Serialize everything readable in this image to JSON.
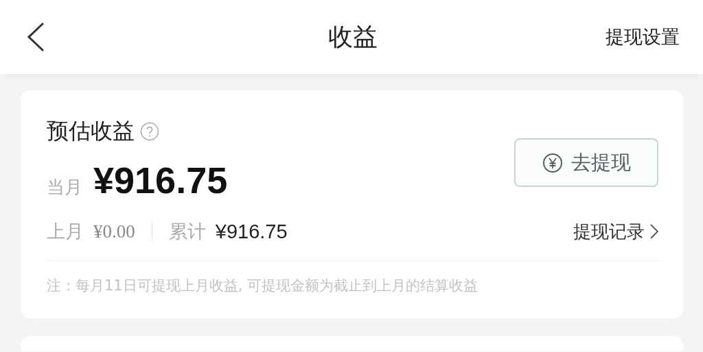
{
  "header": {
    "title": "收益",
    "action": "提现设置"
  },
  "earnings_card": {
    "title": "预估收益",
    "period_label": "当月",
    "amount": "¥916.75",
    "withdraw_button": "去提现",
    "last_month_label": "上月",
    "last_month_value": "¥0.00",
    "total_label": "累计",
    "total_value": "¥916.75",
    "records_link": "提现记录",
    "note": "注：每月11日可提现上月收益, 可提现金额为截止到上月的结算收益"
  }
}
